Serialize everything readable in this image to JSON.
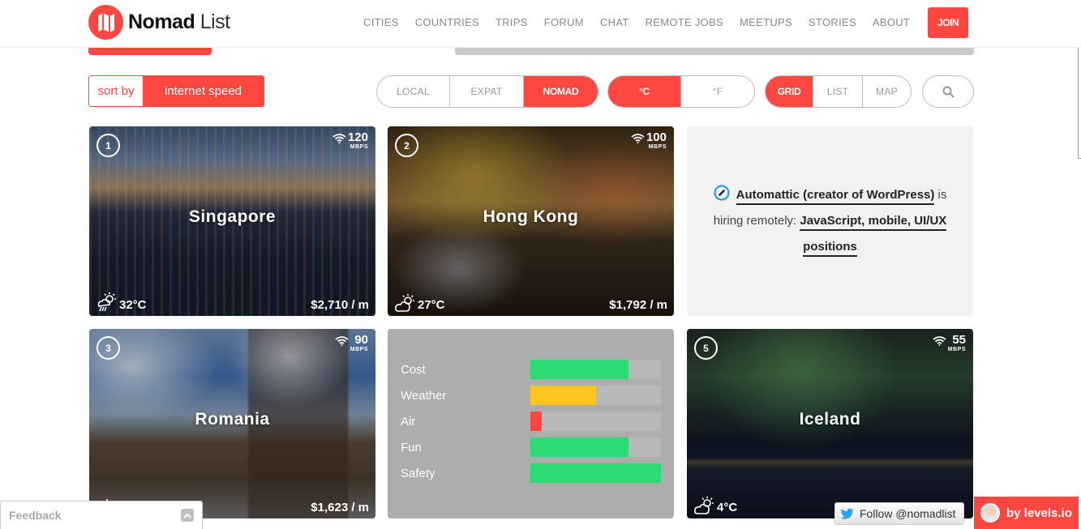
{
  "header": {
    "brand_bold": "Nomad",
    "brand_light": "List",
    "nav": [
      "CITIES",
      "COUNTRIES",
      "TRIPS",
      "FORUM",
      "CHAT",
      "REMOTE JOBS",
      "MEETUPS",
      "STORIES",
      "ABOUT"
    ],
    "join_label": "JOIN"
  },
  "filters": {
    "sort_label": "sort by",
    "sort_value": "internet speed",
    "cost_mode": {
      "options": [
        "LOCAL",
        "EXPAT",
        "NOMAD"
      ],
      "selected": "NOMAD"
    },
    "temp_unit": {
      "options": [
        "°C",
        "°F"
      ],
      "selected": "°C"
    },
    "view_mode": {
      "options": [
        "GRID",
        "LIST",
        "MAP"
      ],
      "selected": "GRID"
    },
    "search_icon": "search-icon"
  },
  "cities": [
    {
      "rank": "1",
      "name": "Singapore",
      "speed": "120",
      "speed_unit": "MBPS",
      "weather_icon": "rain-sun-icon",
      "temp": "32°C",
      "cost": "$2,710 / m"
    },
    {
      "rank": "2",
      "name": "Hong Kong",
      "speed": "100",
      "speed_unit": "MBPS",
      "weather_icon": "partly-cloudy-icon",
      "temp": "27°C",
      "cost": "$1,792 / m"
    },
    {
      "rank": "3",
      "name": "Romania",
      "speed": "90",
      "speed_unit": "MBPS",
      "weather_icon": "sun-icon",
      "temp": "",
      "cost": "$1,623 / m"
    },
    {
      "rank": "5",
      "name": "Iceland",
      "speed": "55",
      "speed_unit": "MBPS",
      "weather_icon": "partly-cloudy-icon",
      "temp": "4°C",
      "cost": ""
    }
  ],
  "ad": {
    "company": "Automattic (creator of WordPress)",
    "middle": " is hiring remotely: ",
    "positions": "JavaScript, mobile, UI/UX positions"
  },
  "stats": [
    {
      "label": "Cost",
      "score": 0.75,
      "color": "#2adb76"
    },
    {
      "label": "Weather",
      "score": 0.5,
      "color": "#ffc520"
    },
    {
      "label": "Air",
      "score": 0.09,
      "color": "#ff4742"
    },
    {
      "label": "Fun",
      "score": 0.75,
      "color": "#2adb76"
    },
    {
      "label": "Safety",
      "score": 1.0,
      "color": "#2adb76"
    }
  ],
  "widgets": {
    "feedback_label": "Feedback",
    "follow_label": "Follow @nomadlist",
    "levels_label": "by levels.io"
  },
  "colors": {
    "accent": "#ff4742",
    "ad_link_icon": "#2a9fd8"
  }
}
